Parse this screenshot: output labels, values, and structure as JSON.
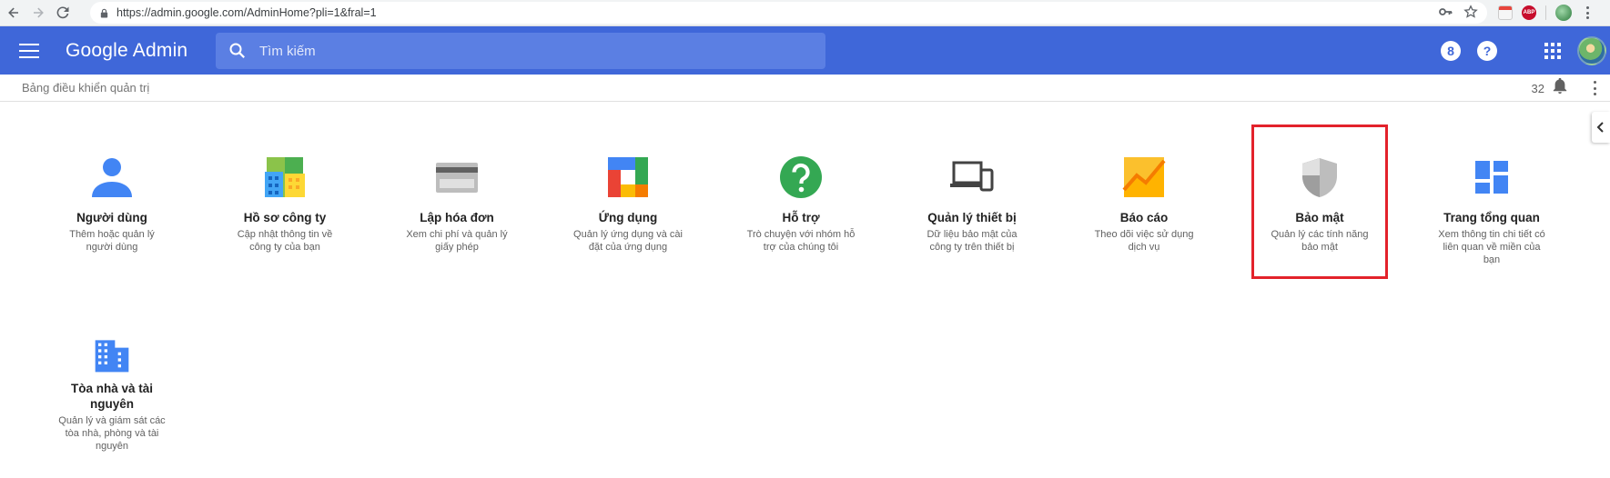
{
  "browser": {
    "url": "https://admin.google.com/AdminHome?pli=1&fral=1",
    "abp_label": "ABP"
  },
  "appbar": {
    "brand": "Google Admin",
    "search_placeholder": "Tìm kiếm",
    "help_glyph": "?",
    "support_glyph": "8"
  },
  "crumbbar": {
    "breadcrumb": "Bảng điều khiển quản trị",
    "notification_count": "32"
  },
  "tiles": [
    {
      "title": "Người dùng",
      "desc": "Thêm hoặc quản lý người dùng"
    },
    {
      "title": "Hồ sơ công ty",
      "desc": "Cập nhật thông tin về công ty của bạn"
    },
    {
      "title": "Lập hóa đơn",
      "desc": "Xem chi phí và quản lý giấy phép"
    },
    {
      "title": "Ứng dụng",
      "desc": "Quản lý ứng dụng và cài đặt của ứng dụng"
    },
    {
      "title": "Hỗ trợ",
      "desc": "Trò chuyện với nhóm hỗ trợ của chúng tôi"
    },
    {
      "title": "Quản lý thiết bị",
      "desc": "Dữ liệu bảo mật của công ty trên thiết bị"
    },
    {
      "title": "Báo cáo",
      "desc": "Theo dõi việc sử dụng dịch vụ"
    },
    {
      "title": "Bảo mật",
      "desc": "Quản lý các tính năng bảo mật"
    },
    {
      "title": "Trang tổng quan",
      "desc": "Xem thông tin chi tiết có liên quan về miền của bạn"
    },
    {
      "title": "Tòa nhà và tài nguyên",
      "desc": "Quản lý và giám sát các tòa nhà, phòng và tài nguyên"
    }
  ],
  "colors": {
    "appbar": "#3f67d9",
    "highlight": "#e3222b"
  }
}
